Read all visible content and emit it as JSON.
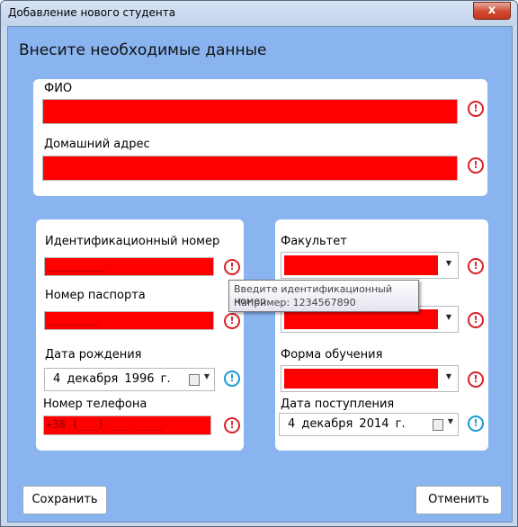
{
  "window": {
    "title": "Добавление нового студента",
    "close_glyph": "x"
  },
  "heading": "Внесите необходимые данные",
  "top_panel": {
    "fio_label": "ФИО",
    "address_label": "Домашний адрес"
  },
  "left_panel": {
    "id_label": "Идентификационный номер",
    "id_mask": "_________",
    "passport_label": "Номер паспорта",
    "passport_mask": "________",
    "birth_label": "Дата рождения",
    "birth_value": "4 декабря 1996 г.",
    "phone_label": "Номер телефона",
    "phone_mask": "+38 (___) ___ ____"
  },
  "right_panel": {
    "faculty_label": "Факультет",
    "study_form_label": "Форма обучения",
    "admission_label": "Дата поступления",
    "admission_value": "4 декабря 2014 г."
  },
  "tooltip": {
    "line1": "Введите идентификационный номер",
    "line2": "Например: 1234567890"
  },
  "buttons": {
    "save": "Сохранить",
    "cancel": "Отменить"
  },
  "icons": {
    "error": "!",
    "info": "!",
    "dropdown": "▼"
  },
  "colors": {
    "invalid_field": "#ff0000",
    "client_bg": "#89b4f0",
    "error_icon": "#d8222a",
    "info_icon": "#1a9ad6"
  }
}
